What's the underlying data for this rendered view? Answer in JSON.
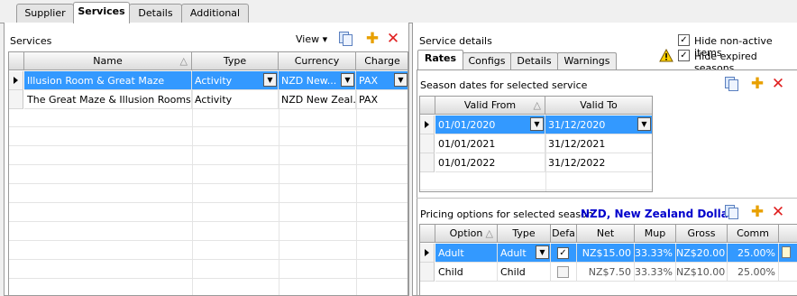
{
  "top_tabs": [
    "Supplier",
    "Services",
    "Details",
    "Additional"
  ],
  "services": {
    "title": "Services",
    "view_label": "View",
    "columns": [
      "Name",
      "Type",
      "Currency",
      "Charge"
    ],
    "rows": [
      {
        "name": "Illusion Room & Great Maze",
        "type": "Activity",
        "currency": "NZD New...",
        "charge": "PAX"
      },
      {
        "name": "The Great Maze & Illusion Rooms",
        "type": "Activity",
        "currency": "NZD New Zeal...",
        "charge": "PAX"
      }
    ]
  },
  "details": {
    "title": "Service details",
    "hide_nonactive_label": "Hide non-active items",
    "hide_expired_label": "Hide expired seasons",
    "tabs": [
      "Rates",
      "Configs",
      "Details",
      "Warnings"
    ],
    "season_title": "Season dates for selected service",
    "season_columns": [
      "Valid From",
      "Valid To"
    ],
    "season_rows": [
      {
        "from": "01/01/2020",
        "to": "31/12/2020"
      },
      {
        "from": "01/01/2021",
        "to": "31/12/2021"
      },
      {
        "from": "01/01/2022",
        "to": "31/12/2022"
      }
    ],
    "pricing_title": "Pricing options for selected season.",
    "pricing_currency": "NZD, New Zealand Dollar",
    "pricing_columns": [
      "Option",
      "Type",
      "Defa",
      "Net",
      "Mup",
      "Gross",
      "Comm"
    ],
    "pricing_rows": [
      {
        "option": "Adult",
        "type": "Adult",
        "default": "✓",
        "net": "NZ$15.00",
        "mup": "33.33%",
        "gross": "NZ$20.00",
        "comm": "25.00%"
      },
      {
        "option": "Child",
        "type": "Child",
        "default": "",
        "net": "NZ$7.50",
        "mup": "33.33%",
        "gross": "NZ$10.00",
        "comm": "25.00%"
      }
    ]
  },
  "colors": {
    "selection": "#3399ff",
    "accent_blue": "#0000cc",
    "add_orange": "#e8a000",
    "delete_red": "#e02020"
  }
}
